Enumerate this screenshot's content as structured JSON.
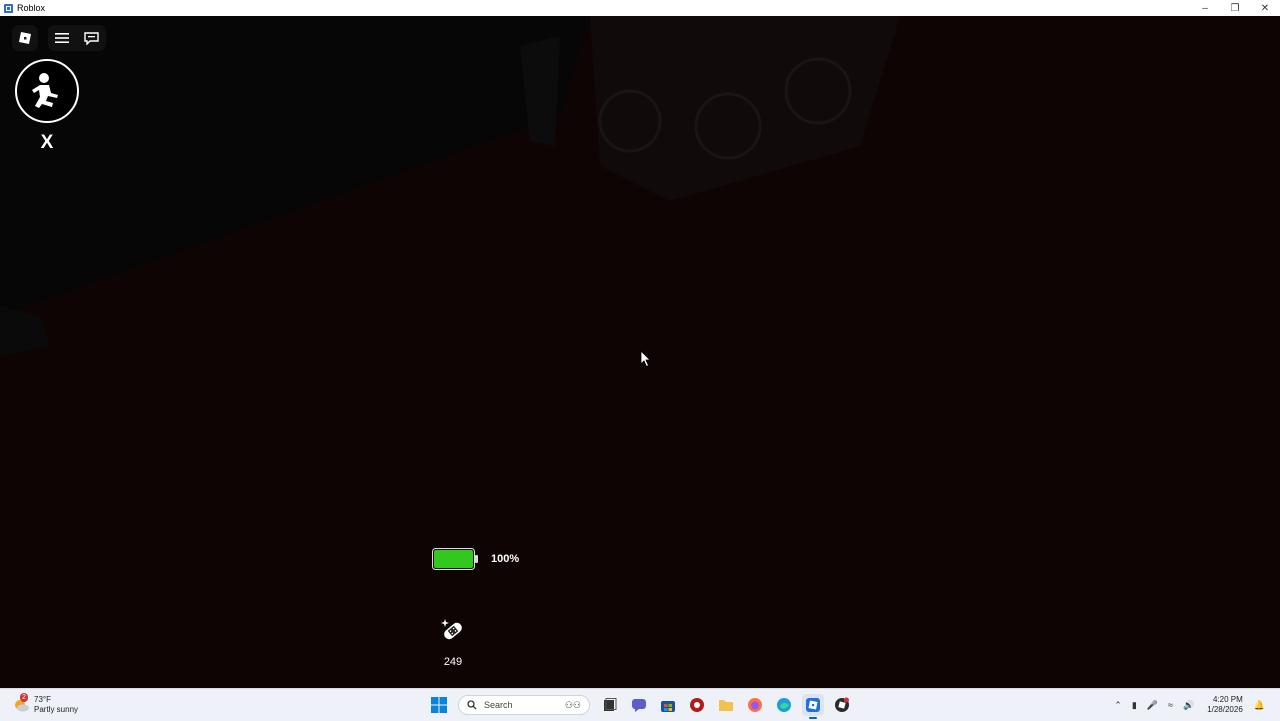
{
  "window": {
    "title": "Roblox",
    "controls": [
      "minimize",
      "restore",
      "close"
    ]
  },
  "hud": {
    "sprint_key": "X",
    "battery_percent_label": "100%",
    "battery_level": 1.0,
    "battery_color": "#32c81e",
    "item_count": "249"
  },
  "taskbar": {
    "weather": {
      "temp": "73°F",
      "condition": "Partly sunny",
      "badge": "2"
    },
    "search_placeholder": "Search",
    "apps": [
      "start-icon",
      "search-icon",
      "widgets-icon",
      "task-view-icon",
      "chat-icon",
      "store-icon",
      "app-red-icon",
      "file-explorer-icon",
      "firefox-icon",
      "edge-icon",
      "roblox-icon",
      "roblox-studio-icon"
    ],
    "clock": {
      "time": "4:20 PM",
      "date": "1/28/2026"
    }
  },
  "colors": {
    "accent": "#0067c0",
    "background": "#0e0404"
  }
}
